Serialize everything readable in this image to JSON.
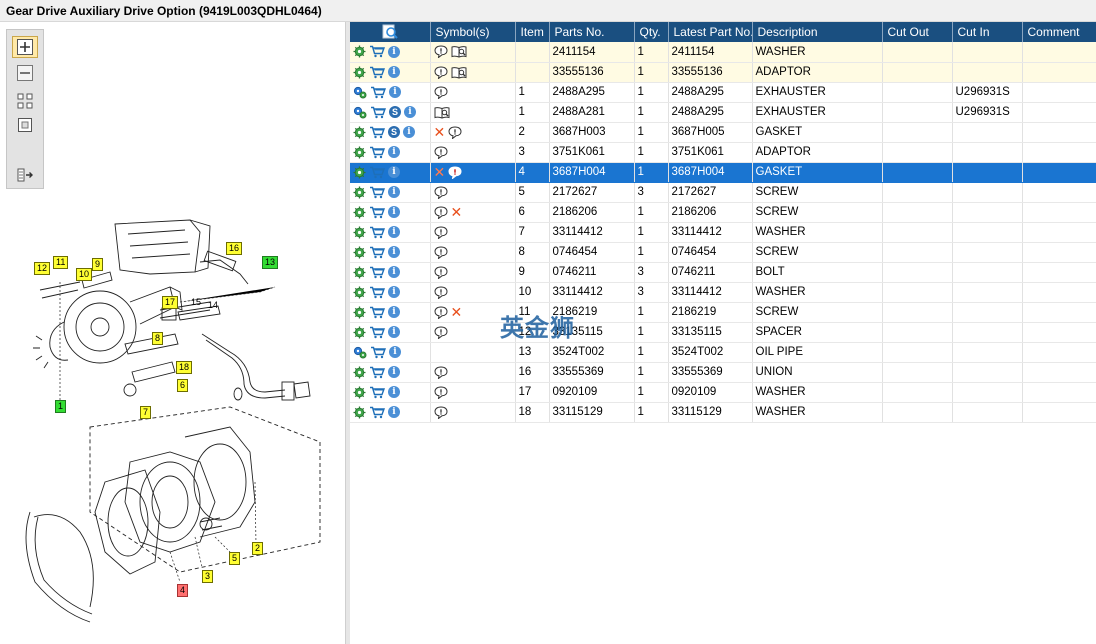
{
  "window": {
    "title": "Gear Drive Auxiliary Drive Option (9419L003QDHL0464)"
  },
  "colors": {
    "header_bg": "#1a4f80",
    "selected_row": "#1a75d1",
    "highlight_row": "#fffbe3",
    "callout_yellow": "#ffff33",
    "callout_green": "#33dd33",
    "callout_red": "#ff7070"
  },
  "toolbar": {
    "buttons": [
      {
        "name": "zoom-in-icon",
        "active": true
      },
      {
        "name": "zoom-out-icon",
        "active": false
      },
      {
        "name": "fit-grid-icon",
        "active": false
      },
      {
        "name": "actual-size-icon",
        "active": false
      },
      {
        "name": "panel-toggle-icon",
        "active": false
      }
    ]
  },
  "diagram": {
    "callouts": [
      {
        "label": "12",
        "color": "yellow"
      },
      {
        "label": "11",
        "color": "yellow"
      },
      {
        "label": "10",
        "color": "yellow"
      },
      {
        "label": "9",
        "color": "yellow"
      },
      {
        "label": "16",
        "color": "yellow"
      },
      {
        "label": "13",
        "color": "green"
      },
      {
        "label": "17",
        "color": "yellow"
      },
      {
        "label": "15",
        "color": "plain"
      },
      {
        "label": "14",
        "color": "plain"
      },
      {
        "label": "8",
        "color": "yellow"
      },
      {
        "label": "18",
        "color": "yellow"
      },
      {
        "label": "6",
        "color": "yellow"
      },
      {
        "label": "7",
        "color": "yellow"
      },
      {
        "label": "1",
        "color": "green"
      },
      {
        "label": "2",
        "color": "yellow"
      },
      {
        "label": "5",
        "color": "yellow"
      },
      {
        "label": "3",
        "color": "yellow"
      },
      {
        "label": "4",
        "color": "red"
      }
    ]
  },
  "grid": {
    "columns": [
      "",
      "Symbol(s)",
      "Item",
      "Parts No.",
      "Qty.",
      "Latest Part No.",
      "Description",
      "Cut Out",
      "Cut In",
      "Comment"
    ],
    "rows": [
      {
        "style": "hl",
        "gear": "green",
        "s": false,
        "symbols": [
          "comment",
          "manual"
        ],
        "item": "",
        "part": "2411154",
        "qty": "1",
        "latest": "2411154",
        "desc": "WASHER",
        "cut_out": "",
        "cut_in": "",
        "comment": ""
      },
      {
        "style": "hl",
        "gear": "green",
        "s": false,
        "symbols": [
          "comment",
          "manual"
        ],
        "item": "",
        "part": "33555136",
        "qty": "1",
        "latest": "33555136",
        "desc": "ADAPTOR",
        "cut_out": "",
        "cut_in": "",
        "comment": ""
      },
      {
        "style": "",
        "gear": "multi",
        "s": false,
        "symbols": [
          "comment"
        ],
        "item": "1",
        "part": "2488A295",
        "qty": "1",
        "latest": "2488A295",
        "desc": "EXHAUSTER",
        "cut_out": "",
        "cut_in": "U296931S",
        "comment": ""
      },
      {
        "style": "",
        "gear": "multi",
        "s": true,
        "symbols": [
          "manual"
        ],
        "item": "1",
        "part": "2488A281",
        "qty": "1",
        "latest": "2488A295",
        "desc": "EXHAUSTER",
        "cut_out": "",
        "cut_in": "U296931S",
        "comment": ""
      },
      {
        "style": "",
        "gear": "green",
        "s": true,
        "symbols": [
          "x",
          "comment"
        ],
        "item": "2",
        "part": "3687H003",
        "qty": "1",
        "latest": "3687H005",
        "desc": "GASKET",
        "cut_out": "",
        "cut_in": "",
        "comment": ""
      },
      {
        "style": "",
        "gear": "green",
        "s": false,
        "symbols": [
          "comment"
        ],
        "item": "3",
        "part": "3751K061",
        "qty": "1",
        "latest": "3751K061",
        "desc": "ADAPTOR",
        "cut_out": "",
        "cut_in": "",
        "comment": ""
      },
      {
        "style": "sel",
        "gear": "green",
        "s": false,
        "symbols": [
          "x",
          "comment-alert"
        ],
        "item": "4",
        "part": "3687H004",
        "qty": "1",
        "latest": "3687H004",
        "desc": "GASKET",
        "cut_out": "",
        "cut_in": "",
        "comment": ""
      },
      {
        "style": "",
        "gear": "green",
        "s": false,
        "symbols": [
          "comment"
        ],
        "item": "5",
        "part": "2172627",
        "qty": "3",
        "latest": "2172627",
        "desc": "SCREW",
        "cut_out": "",
        "cut_in": "",
        "comment": ""
      },
      {
        "style": "",
        "gear": "green",
        "s": false,
        "symbols": [
          "comment",
          "x"
        ],
        "item": "6",
        "part": "2186206",
        "qty": "1",
        "latest": "2186206",
        "desc": "SCREW",
        "cut_out": "",
        "cut_in": "",
        "comment": ""
      },
      {
        "style": "",
        "gear": "green",
        "s": false,
        "symbols": [
          "comment"
        ],
        "item": "7",
        "part": "33114412",
        "qty": "1",
        "latest": "33114412",
        "desc": "WASHER",
        "cut_out": "",
        "cut_in": "",
        "comment": ""
      },
      {
        "style": "",
        "gear": "green",
        "s": false,
        "symbols": [
          "comment"
        ],
        "item": "8",
        "part": "0746454",
        "qty": "1",
        "latest": "0746454",
        "desc": "SCREW",
        "cut_out": "",
        "cut_in": "",
        "comment": ""
      },
      {
        "style": "",
        "gear": "green",
        "s": false,
        "symbols": [
          "comment"
        ],
        "item": "9",
        "part": "0746211",
        "qty": "3",
        "latest": "0746211",
        "desc": "BOLT",
        "cut_out": "",
        "cut_in": "",
        "comment": ""
      },
      {
        "style": "",
        "gear": "green",
        "s": false,
        "symbols": [
          "comment"
        ],
        "item": "10",
        "part": "33114412",
        "qty": "3",
        "latest": "33114412",
        "desc": "WASHER",
        "cut_out": "",
        "cut_in": "",
        "comment": ""
      },
      {
        "style": "",
        "gear": "green",
        "s": false,
        "symbols": [
          "comment",
          "x"
        ],
        "item": "11",
        "part": "2186219",
        "qty": "1",
        "latest": "2186219",
        "desc": "SCREW",
        "cut_out": "",
        "cut_in": "",
        "comment": ""
      },
      {
        "style": "",
        "gear": "green",
        "s": false,
        "symbols": [
          "comment"
        ],
        "item": "12",
        "part": "33135115",
        "qty": "1",
        "latest": "33135115",
        "desc": "SPACER",
        "cut_out": "",
        "cut_in": "",
        "comment": ""
      },
      {
        "style": "",
        "gear": "multi",
        "s": false,
        "symbols": [],
        "item": "13",
        "part": "3524T002",
        "qty": "1",
        "latest": "3524T002",
        "desc": "OIL PIPE",
        "cut_out": "",
        "cut_in": "",
        "comment": ""
      },
      {
        "style": "",
        "gear": "green",
        "s": false,
        "symbols": [
          "comment"
        ],
        "item": "16",
        "part": "33555369",
        "qty": "1",
        "latest": "33555369",
        "desc": "UNION",
        "cut_out": "",
        "cut_in": "",
        "comment": ""
      },
      {
        "style": "",
        "gear": "green",
        "s": false,
        "symbols": [
          "comment"
        ],
        "item": "17",
        "part": "0920109",
        "qty": "1",
        "latest": "0920109",
        "desc": "WASHER",
        "cut_out": "",
        "cut_in": "",
        "comment": ""
      },
      {
        "style": "",
        "gear": "green",
        "s": false,
        "symbols": [
          "comment"
        ],
        "item": "18",
        "part": "33115129",
        "qty": "1",
        "latest": "33115129",
        "desc": "WASHER",
        "cut_out": "",
        "cut_in": "",
        "comment": ""
      }
    ]
  },
  "watermark": {
    "text": "英金狮"
  }
}
